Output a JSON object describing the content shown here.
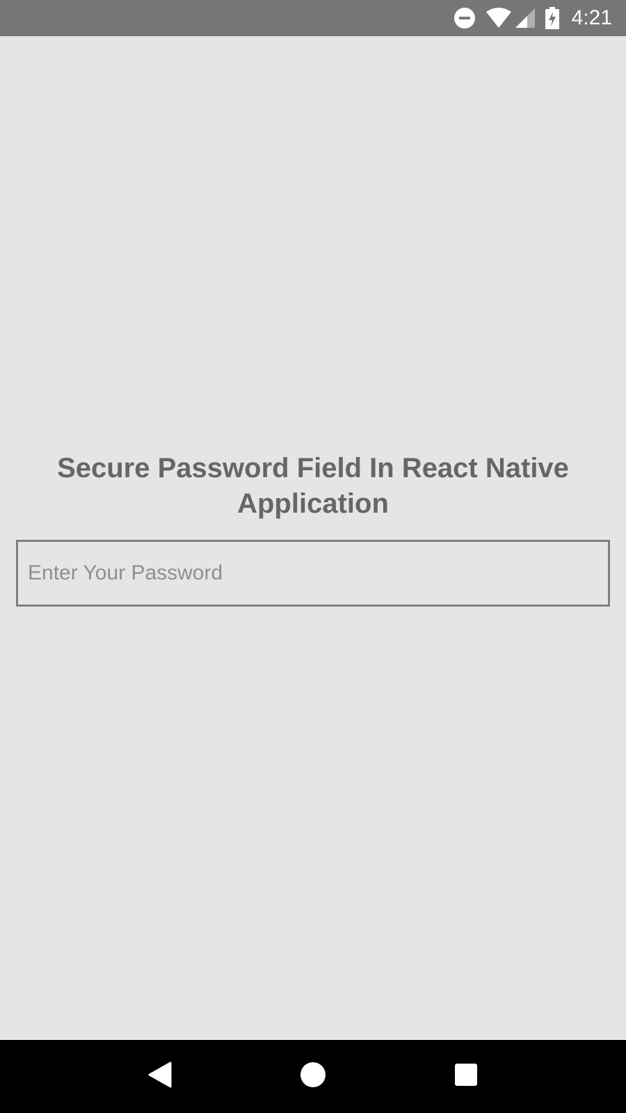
{
  "status_bar": {
    "time": "4:21",
    "icons": [
      "do-not-disturb-icon",
      "wifi-icon",
      "cell-signal-icon",
      "battery-charging-icon"
    ]
  },
  "main": {
    "title": "Secure Password Field In React Native Application",
    "password_field": {
      "value": "",
      "placeholder": "Enter Your Password"
    }
  },
  "nav_bar": {
    "buttons": [
      "back-icon",
      "home-icon",
      "recents-icon"
    ]
  },
  "colors": {
    "status_bar_bg": "#767676",
    "screen_bg": "#e5e5e5",
    "title_text": "#666666",
    "input_border": "#7f7f7f",
    "nav_bar_bg": "#000000"
  }
}
